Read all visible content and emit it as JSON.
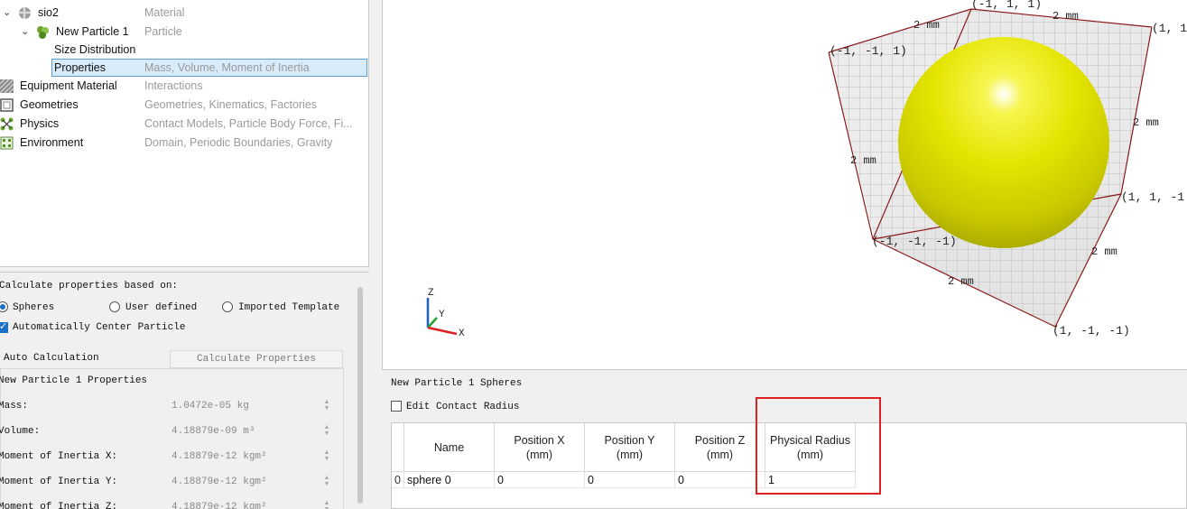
{
  "tree": {
    "items": [
      {
        "label": "sio2",
        "desc": "Material"
      },
      {
        "label": "New Particle 1",
        "desc": "Particle"
      },
      {
        "label": "Size Distribution",
        "desc": ""
      },
      {
        "label": "Properties",
        "desc": "Mass, Volume, Moment of Inertia"
      },
      {
        "label": "Equipment Material",
        "desc": "Interactions"
      },
      {
        "label": "Geometries",
        "desc": "Geometries, Kinematics, Factories"
      },
      {
        "label": "Physics",
        "desc": "Contact Models, Particle Body Force, Fi..."
      },
      {
        "label": "Environment",
        "desc": "Domain, Periodic Boundaries, Gravity"
      }
    ],
    "selected_index": 3
  },
  "properties": {
    "calc_based_on": "Calculate properties based on:",
    "options": [
      "Spheres",
      "User defined",
      "Imported Template"
    ],
    "selected_option": "Spheres",
    "auto_center": "Automatically Center Particle",
    "auto_center_checked": true,
    "auto_calculation": "Auto Calculation",
    "calc_button": "Calculate Properties",
    "group_title": "New Particle 1 Properties",
    "fields": [
      {
        "label": "Mass:",
        "value": "1.0472e-05 kg"
      },
      {
        "label": "Volume:",
        "value": "4.18879e-09 m³"
      },
      {
        "label": "Moment of Inertia X:",
        "value": "4.18879e-12 kgm²"
      },
      {
        "label": "Moment of Inertia Y:",
        "value": "4.18879e-12 kgm²"
      },
      {
        "label": "Moment of Inertia Z:",
        "value": "4.18879e-12 kgm²"
      }
    ]
  },
  "viewport": {
    "corner_labels": [
      "(-1, 1, 1)",
      "(1, 1",
      "(-1, -1, 1)",
      "(1, 1, -1",
      "(-1, -1, -1)",
      "(1, -1, -1)"
    ],
    "dim_label": "2 mm",
    "axes": {
      "x": "X",
      "y": "Y",
      "z": "Z"
    },
    "sphere_color": "#e6e600"
  },
  "spheres": {
    "title": "New Particle 1 Spheres",
    "edit_contact_radius": "Edit Contact Radius",
    "edit_contact_radius_checked": false,
    "columns": [
      "Name",
      "Position X\n(mm)",
      "Position Y\n(mm)",
      "Position Z\n(mm)",
      "Physical Radius\n(mm)"
    ],
    "rows": [
      {
        "index": "0",
        "name": "sphere 0",
        "x": "0",
        "y": "0",
        "z": "0",
        "radius": "1"
      }
    ]
  }
}
